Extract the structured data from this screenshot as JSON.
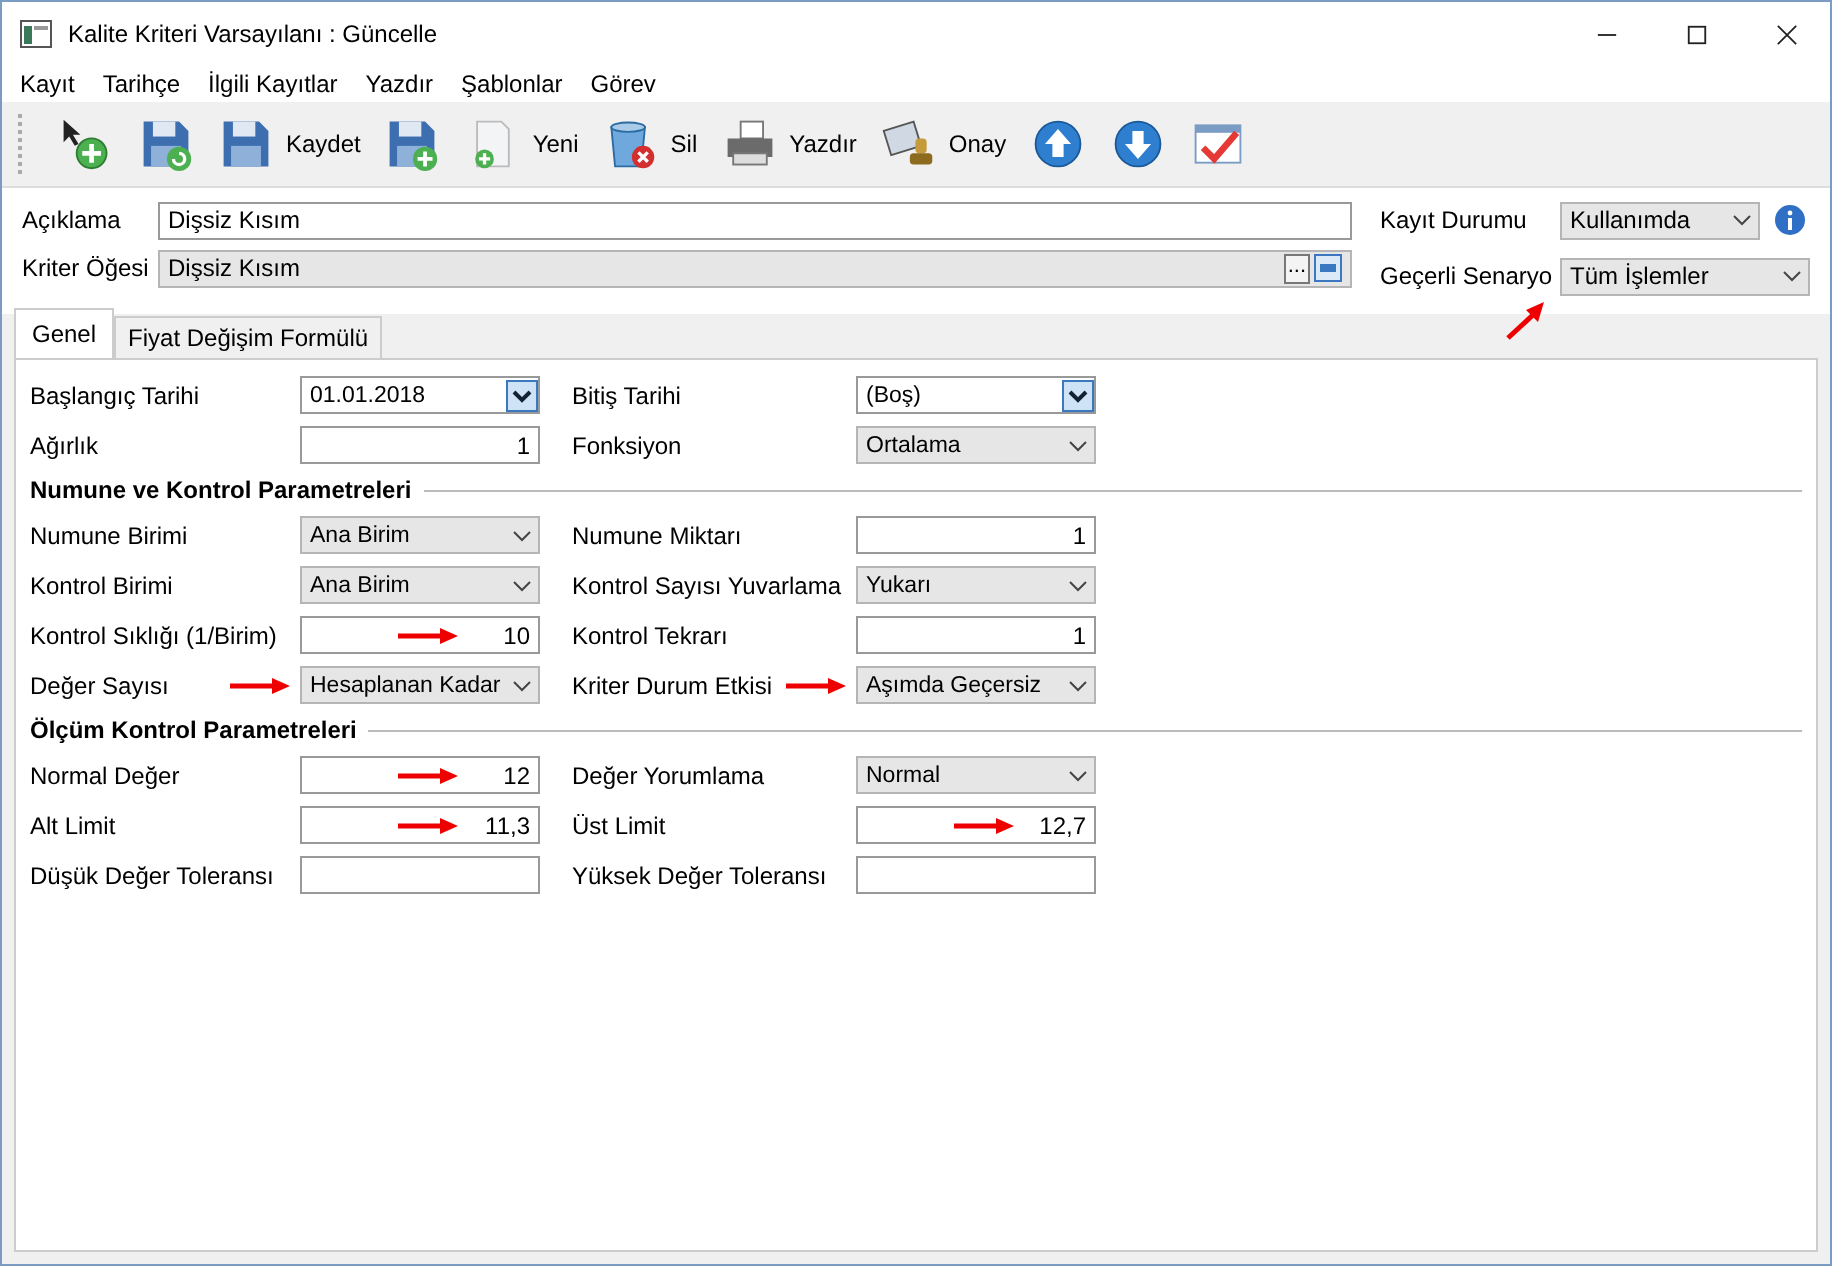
{
  "window": {
    "title": "Kalite Kriteri Varsayılanı : Güncelle"
  },
  "menu": [
    "Kayıt",
    "Tarihçe",
    "İlgili Kayıtlar",
    "Yazdır",
    "Şablonlar",
    "Görev"
  ],
  "toolbar": [
    {
      "kind": "add-record"
    },
    {
      "kind": "save-refresh"
    },
    {
      "kind": "save",
      "label": "Kaydet"
    },
    {
      "kind": "save-add"
    },
    {
      "kind": "new",
      "label": "Yeni"
    },
    {
      "kind": "delete",
      "label": "Sil"
    },
    {
      "kind": "print",
      "label": "Yazdır"
    },
    {
      "kind": "approve",
      "label": "Onay"
    },
    {
      "kind": "up"
    },
    {
      "kind": "down"
    },
    {
      "kind": "check"
    }
  ],
  "header": {
    "description": {
      "label": "Açıklama",
      "value": "Dişsiz Kısım"
    },
    "criterion_item": {
      "label": "Kriter Öğesi",
      "value": "Dişsiz Kısım",
      "browse_button": "..."
    },
    "record_status": {
      "label": "Kayıt Durumu",
      "value": "Kullanımda"
    },
    "scenario": {
      "label": "Geçerli Senaryo",
      "value": "Tüm İşlemler",
      "marked": true
    }
  },
  "tabs": [
    {
      "label": "Genel",
      "selected": true
    },
    {
      "label": "Fiyat Değişim Formülü",
      "selected": false
    }
  ],
  "sections": [
    {
      "rows": [
        {
          "left": {
            "label": "Başlangıç Tarihi",
            "kind": "date",
            "value": "01.01.2018"
          },
          "right": {
            "label": "Bitiş Tarihi",
            "kind": "date",
            "value": "(Boş)"
          }
        },
        {
          "left": {
            "label": "Ağırlık",
            "kind": "number",
            "value": "1"
          },
          "right": {
            "label": "Fonksiyon",
            "kind": "combo",
            "value": "Ortalama"
          }
        }
      ]
    },
    {
      "title": "Numune ve Kontrol Parametreleri",
      "rows": [
        {
          "left": {
            "label": "Numune Birimi",
            "kind": "combo",
            "value": "Ana Birim"
          },
          "right": {
            "label": "Numune Miktarı",
            "kind": "number",
            "value": "1"
          }
        },
        {
          "left": {
            "label": "Kontrol Birimi",
            "kind": "combo",
            "value": "Ana Birim"
          },
          "right": {
            "label": "Kontrol Sayısı Yuvarlama",
            "kind": "combo",
            "value": "Yukarı"
          }
        },
        {
          "left": {
            "label": "Kontrol Sıklığı (1/Birim)",
            "kind": "number",
            "value": "10",
            "marked": true
          },
          "right": {
            "label": "Kontrol Tekrarı",
            "kind": "number",
            "value": "1"
          }
        },
        {
          "left": {
            "label": "Değer Sayısı",
            "kind": "combo",
            "value": "Hesaplanan Kadar",
            "marked": true
          },
          "right": {
            "label": "Kriter Durum Etkisi",
            "kind": "combo",
            "value": "Aşımda Geçersiz",
            "marked": true
          }
        }
      ]
    },
    {
      "title": "Ölçüm Kontrol Parametreleri",
      "rows": [
        {
          "left": {
            "label": "Normal Değer",
            "kind": "number",
            "value": "12",
            "marked": true
          },
          "right": {
            "label": "Değer Yorumlama",
            "kind": "combo",
            "value": "Normal"
          }
        },
        {
          "left": {
            "label": "Alt Limit",
            "kind": "number",
            "value": "11,3",
            "marked": true
          },
          "right": {
            "label": "Üst Limit",
            "kind": "number",
            "value": "12,7",
            "marked": true
          }
        },
        {
          "left": {
            "label": "Düşük Değer Toleransı",
            "kind": "number"
          },
          "right": {
            "label": "Yüksek Değer Toleransı",
            "kind": "number"
          }
        }
      ]
    }
  ]
}
